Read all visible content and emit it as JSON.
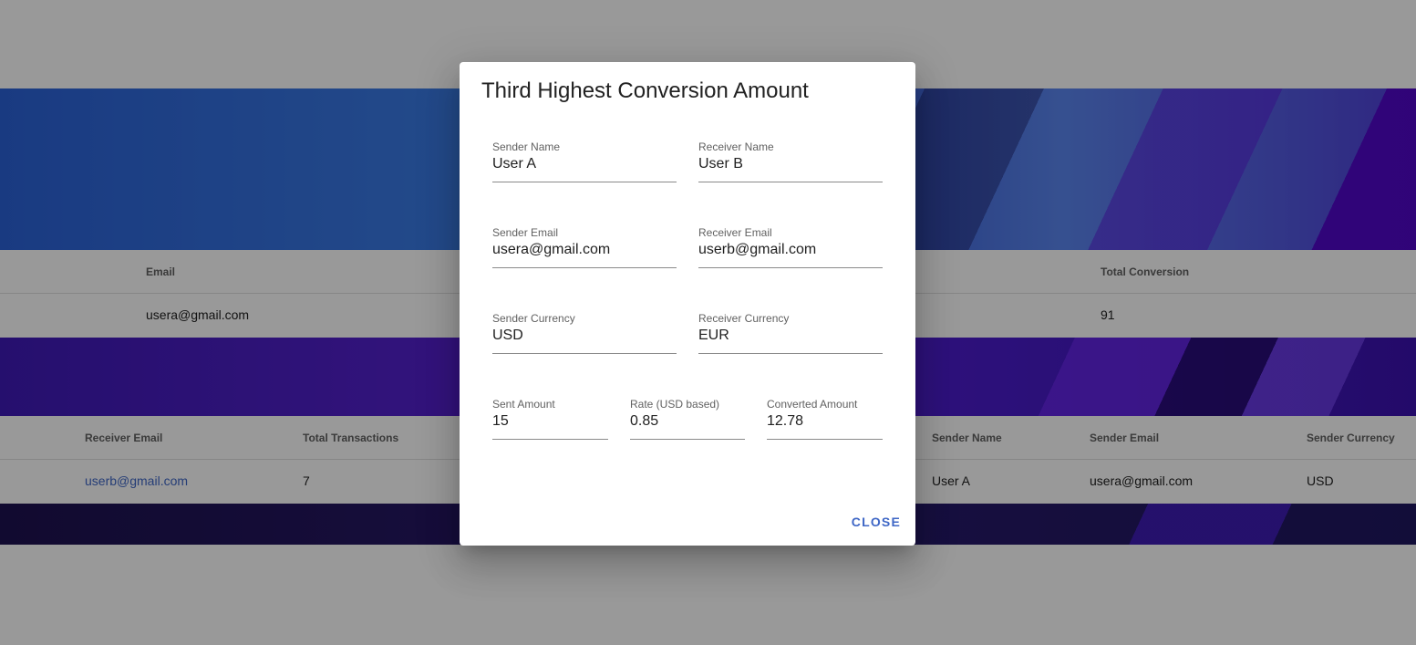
{
  "background": {
    "table1": {
      "headers": {
        "email": "Email",
        "total_conversion": "Total Conversion"
      },
      "row": {
        "email": "usera@gmail.com",
        "total_conversion": "91"
      }
    },
    "table2": {
      "headers": {
        "receiver_email": "Receiver Email",
        "total_transactions": "Total Transactions",
        "sender_name": "Sender Name",
        "sender_email": "Sender Email",
        "sender_currency": "Sender Currency"
      },
      "row": {
        "receiver_email": "userb@gmail.com",
        "total_transactions": "7",
        "sender_name": "User A",
        "sender_email": "usera@gmail.com",
        "sender_currency": "USD"
      }
    }
  },
  "dialog": {
    "title": "Third Highest Conversion Amount",
    "fields": {
      "sender_name": {
        "label": "Sender Name",
        "value": "User A"
      },
      "receiver_name": {
        "label": "Receiver Name",
        "value": "User B"
      },
      "sender_email": {
        "label": "Sender Email",
        "value": "usera@gmail.com"
      },
      "receiver_email": {
        "label": "Receiver Email",
        "value": "userb@gmail.com"
      },
      "sender_currency": {
        "label": "Sender Currency",
        "value": "USD"
      },
      "receiver_currency": {
        "label": "Receiver Currency",
        "value": "EUR"
      },
      "sent_amount": {
        "label": "Sent Amount",
        "value": "15"
      },
      "rate": {
        "label": "Rate (USD based)",
        "value": "0.85"
      },
      "converted_amount": {
        "label": "Converted Amount",
        "value": "12.78"
      }
    },
    "close_label": "CLOSE"
  },
  "colors": {
    "accent": "#3f67c6",
    "scrim": "rgba(0,0,0,0.40)"
  }
}
